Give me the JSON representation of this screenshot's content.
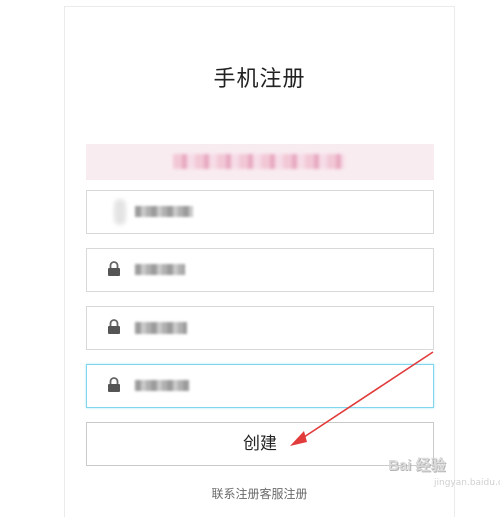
{
  "form": {
    "title": "手机注册",
    "message": "",
    "fields": [
      {
        "icon": "phone-icon",
        "value": "masked"
      },
      {
        "icon": "lock-icon",
        "value": "masked"
      },
      {
        "icon": "lock-icon",
        "value": "masked"
      },
      {
        "icon": "lock-icon",
        "value": "masked"
      }
    ],
    "create_label": "创建",
    "support_link": "联系注册客服注册"
  },
  "watermark": {
    "text": "Bai 经验",
    "sub": "jingyan.baidu.com"
  },
  "colors": {
    "focus_border": "#7fd6ee",
    "message_bg": "#f9ecf1",
    "arrow": "#e23b3b"
  }
}
